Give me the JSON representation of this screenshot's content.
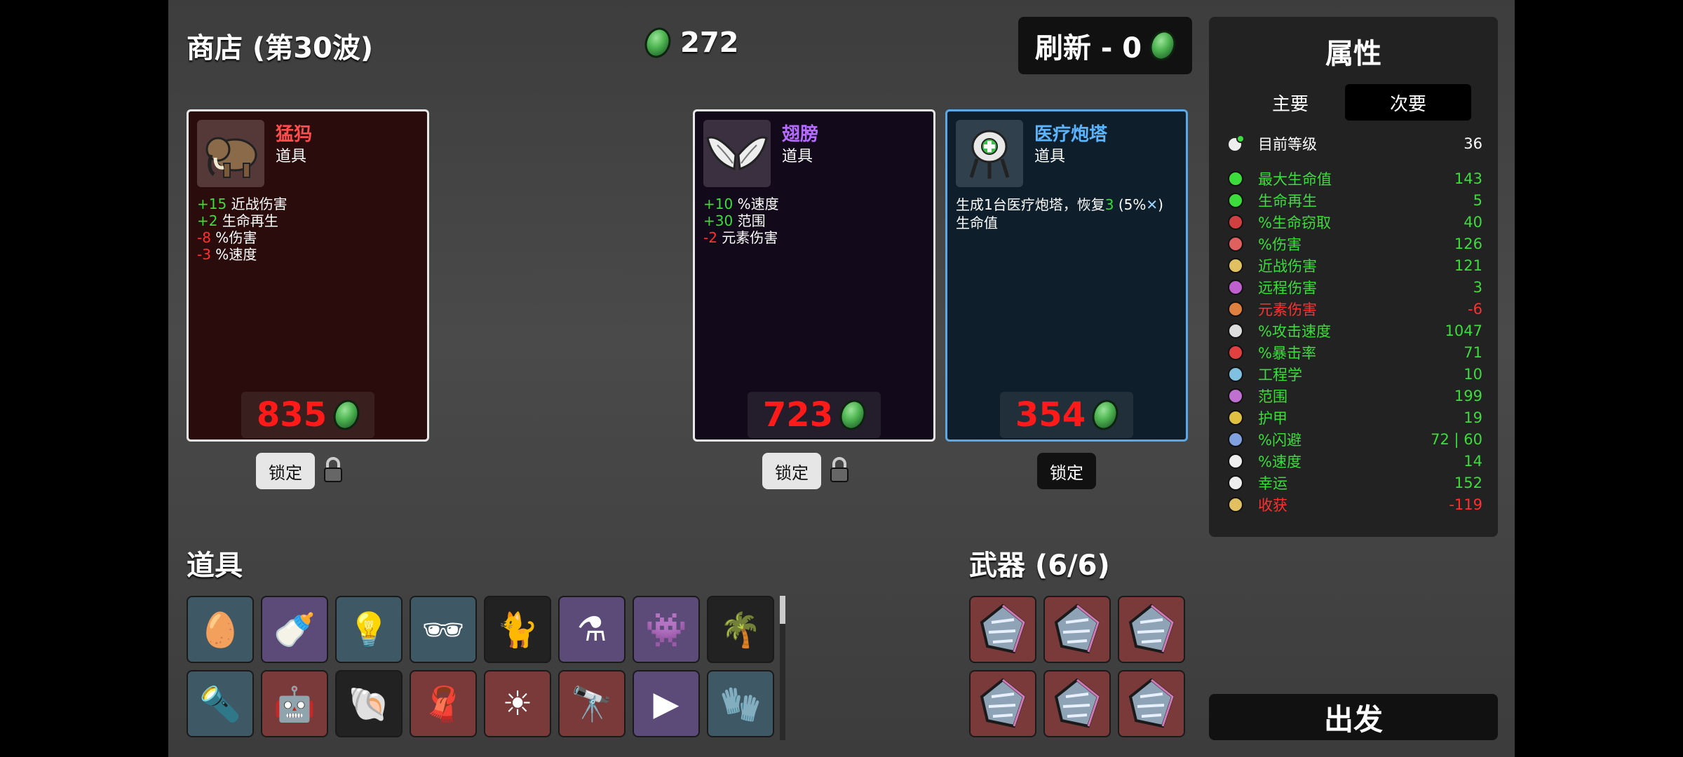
{
  "shop": {
    "title": "商店 (第30波)",
    "gold": "272",
    "refresh_label": "刷新 - 0"
  },
  "cards": [
    {
      "name": "猛犸",
      "type": "道具",
      "name_color": "#ff4d4d",
      "stats": [
        {
          "val": "+15",
          "label": " 近战伤害",
          "sign": "pos"
        },
        {
          "val": "+2",
          "label": " 生命再生",
          "sign": "pos"
        },
        {
          "val": "-8",
          "label": " %伤害",
          "sign": "neg"
        },
        {
          "val": "-3",
          "label": " %速度",
          "sign": "neg"
        }
      ],
      "price": "835",
      "lock_label": "锁定",
      "icon": "mammoth-icon"
    },
    {
      "name": "翅膀",
      "type": "道具",
      "name_color": "#b56bff",
      "stats": [
        {
          "val": "+10",
          "label": " %速度",
          "sign": "pos"
        },
        {
          "val": "+30",
          "label": " 范围",
          "sign": "pos"
        },
        {
          "val": "-2",
          "label": " 元素伤害",
          "sign": "neg"
        }
      ],
      "price": "723",
      "lock_label": "锁定",
      "icon": "wings-icon"
    },
    {
      "name": "医疗炮塔",
      "type": "道具",
      "name_color": "#5ab4ff",
      "description_line1_a": "生成1台医疗炮塔，恢复",
      "description_value": "3",
      "description_line1_b": " (5%",
      "description_line1_c": ")",
      "description_line2": "生命值",
      "price": "354",
      "lock_label": "锁定",
      "icon": "medical-turret-icon"
    }
  ],
  "items_section": {
    "title": "道具",
    "items": [
      "egg-icon",
      "bottle-icon",
      "lamp-icon",
      "glasses-icon",
      "cat-icon",
      "potion-machine-icon",
      "alien-icon",
      "palm-tree-icon",
      "flashlight-icon",
      "robot-icon",
      "snail-shell-icon",
      "cape-icon",
      "sun-orb-icon",
      "binoculars-icon",
      "triangle-icon",
      "scarf-icon"
    ]
  },
  "weapons_section": {
    "title": "武器 (6/6)",
    "weapons": [
      "weapon-icon",
      "weapon-icon",
      "weapon-icon",
      "weapon-icon",
      "weapon-icon",
      "weapon-icon"
    ]
  },
  "stats_panel": {
    "title": "属性",
    "tab_primary": "主要",
    "tab_secondary": "次要",
    "level": {
      "label": "目前等级",
      "value": "36"
    },
    "stats": [
      {
        "label": "最大生命值",
        "value": "143",
        "color": "#3ddc3d",
        "icon": "heart-icon",
        "icolor": "#3ddc3d"
      },
      {
        "label": "生命再生",
        "value": "5",
        "color": "#3ddc3d",
        "icon": "heart-plus-icon",
        "icolor": "#3ddc3d"
      },
      {
        "label": "%生命窃取",
        "value": "40",
        "color": "#3ddc3d",
        "icon": "fangs-icon",
        "icolor": "#d04040"
      },
      {
        "label": "%伤害",
        "value": "126",
        "color": "#3ddc3d",
        "icon": "muscle-icon",
        "icolor": "#e06060"
      },
      {
        "label": "近战伤害",
        "value": "121",
        "color": "#3ddc3d",
        "icon": "sword-icon",
        "icolor": "#e0c060"
      },
      {
        "label": "远程伤害",
        "value": "3",
        "color": "#3ddc3d",
        "icon": "bow-icon",
        "icolor": "#c060d0"
      },
      {
        "label": "元素伤害",
        "value": "-6",
        "color": "#ff3030",
        "icon": "flame-icon",
        "icolor": "#e08040"
      },
      {
        "label": "%攻击速度",
        "value": "1047",
        "color": "#3ddc3d",
        "icon": "hourglass-icon",
        "icolor": "#dddddd"
      },
      {
        "label": "%暴击率",
        "value": "71",
        "color": "#3ddc3d",
        "icon": "crit-icon",
        "icolor": "#e04040"
      },
      {
        "label": "工程学",
        "value": "10",
        "color": "#3ddc3d",
        "icon": "wrench-icon",
        "icolor": "#80c0e0"
      },
      {
        "label": "范围",
        "value": "199",
        "color": "#3ddc3d",
        "icon": "range-icon",
        "icolor": "#c070d0"
      },
      {
        "label": "护甲",
        "value": "19",
        "color": "#3ddc3d",
        "icon": "shield-icon",
        "icolor": "#e0c040"
      },
      {
        "label": "%闪避",
        "value": "72 | 60",
        "color": "#3ddc3d",
        "icon": "dodge-icon",
        "icolor": "#80a0e0"
      },
      {
        "label": "%速度",
        "value": "14",
        "color": "#3ddc3d",
        "icon": "boot-icon",
        "icolor": "#eeeeee"
      },
      {
        "label": "幸运",
        "value": "152",
        "color": "#3ddc3d",
        "icon": "dice-icon",
        "icolor": "#eeeeee"
      },
      {
        "label": "收获",
        "value": "-119",
        "color": "#ff3030",
        "icon": "wheat-icon",
        "icolor": "#e0c060"
      }
    ]
  },
  "go_button": "出发"
}
